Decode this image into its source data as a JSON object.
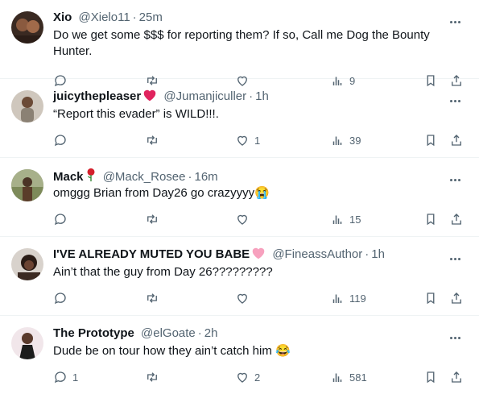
{
  "colors": {
    "text": "#0f1419",
    "muted": "#536471",
    "divider": "#eff3f4",
    "heart_red": "#f91880"
  },
  "icons": {
    "reply": "reply-icon",
    "retweet": "retweet-icon",
    "like": "heart-icon",
    "views": "views-icon",
    "bookmark": "bookmark-icon",
    "share": "share-icon",
    "more": "more-icon"
  },
  "tweets": [
    {
      "name": "Xio",
      "name_emoji": "",
      "handle": "@Xielo11",
      "time": "25m",
      "text": "Do we get some $$$ for reporting them? If so, Call me Dog the Bounty Hunter.",
      "replies": "",
      "retweets": "",
      "likes": "",
      "views": "9"
    },
    {
      "name": "juicythepleaser",
      "name_emoji": "red-heart-emoji",
      "handle": "@Jumanjiculler",
      "time": "1h",
      "text": "“Report this evader” is WILD!!!.",
      "replies": "",
      "retweets": "",
      "likes": "1",
      "views": "39"
    },
    {
      "name": "Mack",
      "name_emoji": "rose-emoji",
      "handle": "@Mack_Rosee",
      "time": "16m",
      "text": "omggg Brian from Day26 go crazyyyy😭",
      "replies": "",
      "retweets": "",
      "likes": "",
      "views": "15"
    },
    {
      "name": "I'VE ALREADY MUTED YOU BABE",
      "name_emoji": "pink-heart-emoji",
      "handle": "@FineassAuthor",
      "time": "1h",
      "text": "Ain’t that the guy from Day 26?????????",
      "replies": "",
      "retweets": "",
      "likes": "",
      "views": "119"
    },
    {
      "name": "The Prototype",
      "name_emoji": "",
      "handle": "@elGoate",
      "time": "2h",
      "text": "Dude be on tour how they ain’t catch him 😂",
      "replies": "1",
      "retweets": "",
      "likes": "2",
      "views": "581"
    }
  ]
}
